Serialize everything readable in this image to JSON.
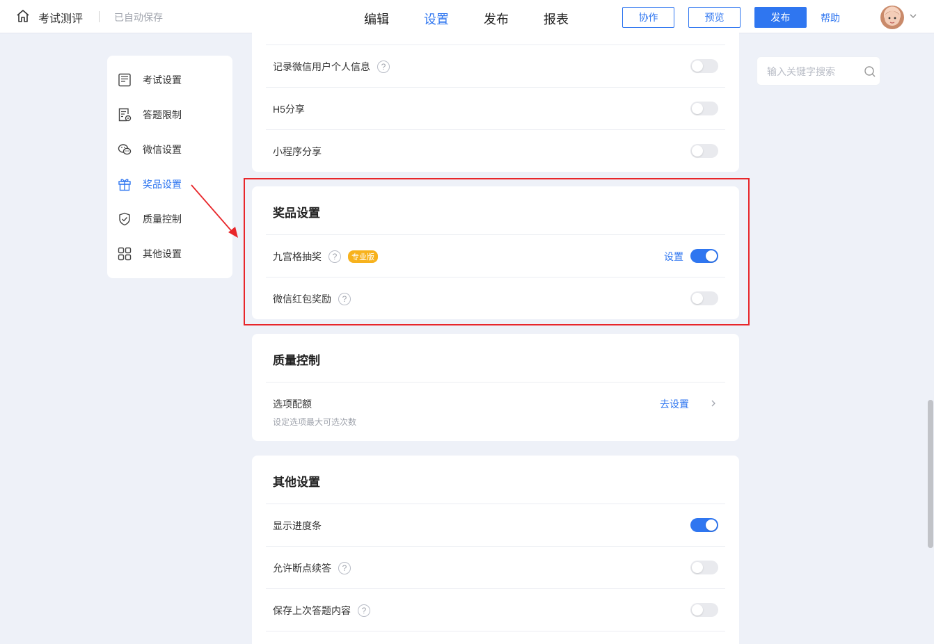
{
  "header": {
    "app_title": "考试测评",
    "autosave": "已自动保存",
    "tabs": [
      {
        "label": "编辑",
        "active": false
      },
      {
        "label": "设置",
        "active": true
      },
      {
        "label": "发布",
        "active": false
      },
      {
        "label": "报表",
        "active": false
      }
    ],
    "collab_label": "协作",
    "preview_label": "预览",
    "publish_label": "发布",
    "help_label": "帮助"
  },
  "sidebar": {
    "items": [
      {
        "label": "考试设置",
        "icon": "exam-icon",
        "active": false
      },
      {
        "label": "答题限制",
        "icon": "limit-icon",
        "active": false
      },
      {
        "label": "微信设置",
        "icon": "wechat-icon",
        "active": false
      },
      {
        "label": "奖品设置",
        "icon": "gift-icon",
        "active": true
      },
      {
        "label": "质量控制",
        "icon": "shield-icon",
        "active": false
      },
      {
        "label": "其他设置",
        "icon": "grid-icon",
        "active": false
      }
    ]
  },
  "wechat_section": {
    "rows": [
      {
        "label": "记录微信用户个人信息",
        "help": true,
        "enabled": false
      },
      {
        "label": "H5分享",
        "help": false,
        "enabled": false
      },
      {
        "label": "小程序分享",
        "help": false,
        "enabled": false
      }
    ]
  },
  "prize_section": {
    "title": "奖品设置",
    "rows": [
      {
        "label": "九宫格抽奖",
        "help": true,
        "badge": "专业版",
        "link": "设置",
        "enabled": true
      },
      {
        "label": "微信红包奖励",
        "help": true,
        "enabled": false
      }
    ]
  },
  "quality_section": {
    "title": "质量控制",
    "rows": [
      {
        "label": "选项配额",
        "sub": "设定选项最大可选次数",
        "link": "去设置"
      }
    ]
  },
  "other_section": {
    "title": "其他设置",
    "rows": [
      {
        "label": "显示进度条",
        "help": false,
        "enabled": true
      },
      {
        "label": "允许断点续答",
        "help": true,
        "enabled": false
      },
      {
        "label": "保存上次答题内容",
        "help": true,
        "enabled": false
      }
    ]
  },
  "search": {
    "placeholder": "输入关键字搜索",
    "value": ""
  },
  "colors": {
    "accent": "#2f76f0",
    "highlight": "#e8262a",
    "badge": "#f7b21d",
    "background": "#eef1f8"
  }
}
